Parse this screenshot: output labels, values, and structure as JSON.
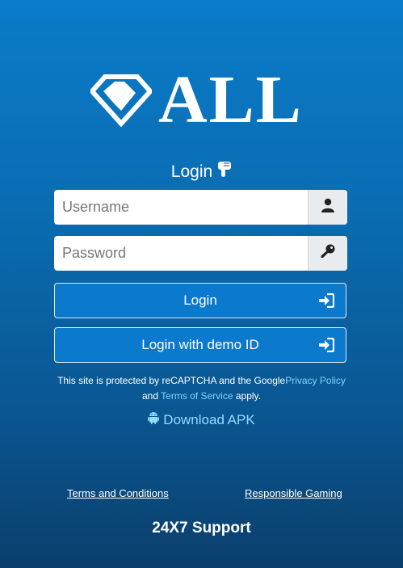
{
  "brand": {
    "logo_text": "ALL",
    "logo_icon": "diamond-icon"
  },
  "login": {
    "heading": "Login",
    "heading_icon": "hand-pointing-down-icon",
    "username_placeholder": "Username",
    "username_icon": "user-icon",
    "password_placeholder": "Password",
    "password_icon": "key-icon",
    "login_button": "Login",
    "demo_button": "Login with demo ID",
    "button_icon": "sign-in-icon"
  },
  "recaptcha": {
    "text_1": "This site is protected by reCAPTCHA and the Google",
    "privacy_link": "Privacy Policy",
    "text_2": "and",
    "terms_link": "Terms of Service",
    "text_3": "apply."
  },
  "download": {
    "label": "Download APK",
    "icon": "android-icon"
  },
  "footer": {
    "terms": "Terms and Conditions",
    "responsible": "Responsible Gaming",
    "support": "24X7 Support"
  },
  "colors": {
    "background_top": "#0a7cc9",
    "background_bottom": "#0b3f6c",
    "button": "#0b79cc",
    "link": "#7fd4ff"
  }
}
